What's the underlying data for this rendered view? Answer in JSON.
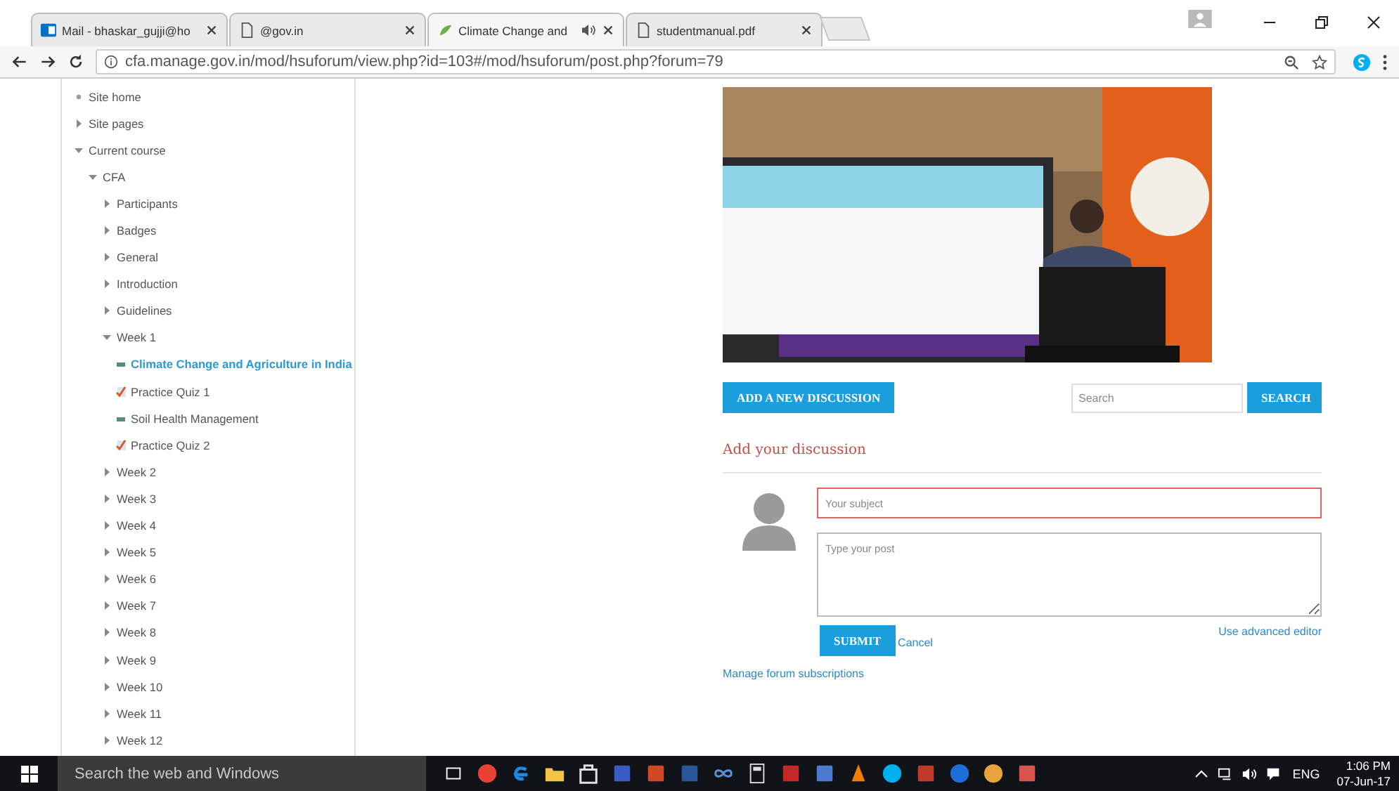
{
  "tabs": [
    {
      "title": "Mail - bhaskar_gujji@ho",
      "kind": "mail",
      "selected": false,
      "audio": false
    },
    {
      "title": "@gov.in",
      "kind": "page",
      "selected": false,
      "audio": false
    },
    {
      "title": "Climate Change and",
      "kind": "leaf",
      "selected": true,
      "audio": true
    },
    {
      "title": "studentmanual.pdf",
      "kind": "page",
      "selected": false,
      "audio": false
    }
  ],
  "address_bar": {
    "url": "cfa.manage.gov.in/mod/hsuforum/view.php?id=103#/mod/hsuforum/post.php?forum=79"
  },
  "sidebar": {
    "items": [
      {
        "label": "Site home",
        "kind": "link",
        "selected": false
      },
      {
        "label": "Site pages",
        "kind": "branch",
        "expanded": false,
        "selected": false
      },
      {
        "label": "Current course",
        "kind": "branch",
        "expanded": true,
        "selected": false,
        "children": [
          {
            "label": "CFA",
            "kind": "branch",
            "expanded": true,
            "selected": false,
            "children": [
              {
                "label": "Participants",
                "kind": "branch",
                "expanded": false,
                "selected": false
              },
              {
                "label": "Badges",
                "kind": "branch",
                "expanded": false,
                "selected": false
              },
              {
                "label": "General",
                "kind": "branch",
                "expanded": false,
                "selected": false
              },
              {
                "label": "Introduction",
                "kind": "branch",
                "expanded": false,
                "selected": false
              },
              {
                "label": "Guidelines",
                "kind": "branch",
                "expanded": false,
                "selected": false
              },
              {
                "label": "Week 1",
                "kind": "branch",
                "expanded": true,
                "selected": false,
                "children": [
                  {
                    "label": "Climate Change and Agriculture in India",
                    "kind": "page",
                    "selected": true
                  },
                  {
                    "label": "Practice Quiz 1",
                    "kind": "quiz",
                    "selected": false
                  },
                  {
                    "label": "Soil Health Management",
                    "kind": "page",
                    "selected": false
                  },
                  {
                    "label": "Practice Quiz 2",
                    "kind": "quiz",
                    "selected": false
                  }
                ]
              },
              {
                "label": "Week 2",
                "kind": "branch",
                "expanded": false,
                "selected": false
              },
              {
                "label": "Week 3",
                "kind": "branch",
                "expanded": false,
                "selected": false
              },
              {
                "label": "Week 4",
                "kind": "branch",
                "expanded": false,
                "selected": false
              },
              {
                "label": "Week 5",
                "kind": "branch",
                "expanded": false,
                "selected": false
              },
              {
                "label": "Week 6",
                "kind": "branch",
                "expanded": false,
                "selected": false
              },
              {
                "label": "Week 7",
                "kind": "branch",
                "expanded": false,
                "selected": false
              },
              {
                "label": "Week 8",
                "kind": "branch",
                "expanded": false,
                "selected": false
              },
              {
                "label": "Week 9",
                "kind": "branch",
                "expanded": false,
                "selected": false
              },
              {
                "label": "Week 10",
                "kind": "branch",
                "expanded": false,
                "selected": false
              },
              {
                "label": "Week 11",
                "kind": "branch",
                "expanded": false,
                "selected": false
              },
              {
                "label": "Week 12",
                "kind": "branch",
                "expanded": false,
                "selected": false
              }
            ]
          }
        ]
      }
    ]
  },
  "forum": {
    "add_button": "ADD A NEW DISCUSSION",
    "search": {
      "placeholder": "Search"
    },
    "search_button": "SEARCH",
    "heading": "Add your discussion",
    "subject": {
      "placeholder": "Your subject",
      "invalid": true
    },
    "post": {
      "placeholder": "Type your post"
    },
    "submit_button": "SUBMIT",
    "cancel_link": "Cancel",
    "advanced_link": "Use advanced editor",
    "subscriptions_link": "Manage forum subscriptions"
  },
  "taskbar": {
    "search": {
      "placeholder": "Search the web and Windows"
    },
    "language": "ENG",
    "time": "1:06 PM",
    "date": "07-Jun-17"
  }
}
